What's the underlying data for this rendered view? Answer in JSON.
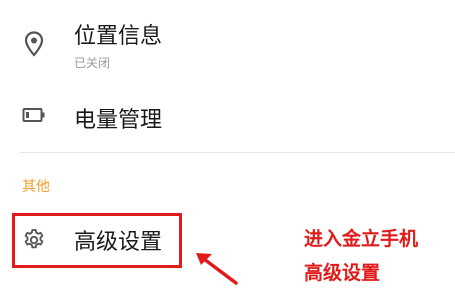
{
  "settings": {
    "location": {
      "title": "位置信息",
      "subtitle": "已关闭",
      "icon": "location-pin-icon"
    },
    "battery": {
      "title": "电量管理",
      "icon": "battery-icon"
    },
    "section_other": {
      "header": "其他"
    },
    "advanced": {
      "title": "高级设置",
      "icon": "gear-icon"
    }
  },
  "annotation": {
    "line1": "进入金立手机",
    "line2": "高级设置",
    "color": "#e11a1a"
  },
  "colors": {
    "section_header": "#f0a22e",
    "highlight": "#e11a1a"
  }
}
